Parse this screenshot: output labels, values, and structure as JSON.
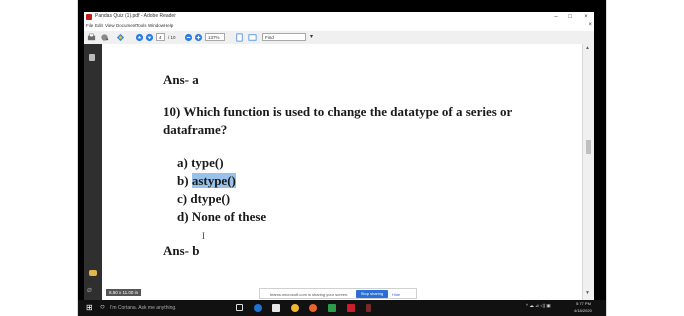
{
  "window": {
    "title": "Pandas Quiz (1).pdf - Adobe Reader",
    "minimize": "–",
    "maximize": "□",
    "close": "×"
  },
  "menu": {
    "items": [
      "File",
      "Edit",
      "View",
      "Document",
      "Tools",
      "Window",
      "Help"
    ],
    "close": "×"
  },
  "toolbar": {
    "page_current": "4",
    "page_total": "/ 10",
    "zoom": "137%",
    "find_placeholder": "Find"
  },
  "document": {
    "ans_a": "Ans- a",
    "question_line1": "10) Which function is used to change the datatype of a series or",
    "question_line2": "dataframe?",
    "option_a": "a) type()",
    "option_b_prefix": "b) ",
    "option_b_highlight": "astype()",
    "option_c": "c) dtype()",
    "option_d": "d) None of these",
    "ans_b": "Ans- b",
    "cursor": "I",
    "page_size": "8.50 x 11.00 in"
  },
  "share_bar": {
    "text": "teams.microsoft.com is sharing your screen.",
    "stop_label": "Stop sharing",
    "hide_label": "Hide"
  },
  "taskbar": {
    "cortana_placeholder": "I'm Cortana. Ask me anything.",
    "time": "5:77 PM",
    "date": "4/18/2020"
  },
  "colors": {
    "highlight": "#99c1e9",
    "stop_button": "#2b6fd6",
    "sidebar": "#2f2f2f"
  }
}
